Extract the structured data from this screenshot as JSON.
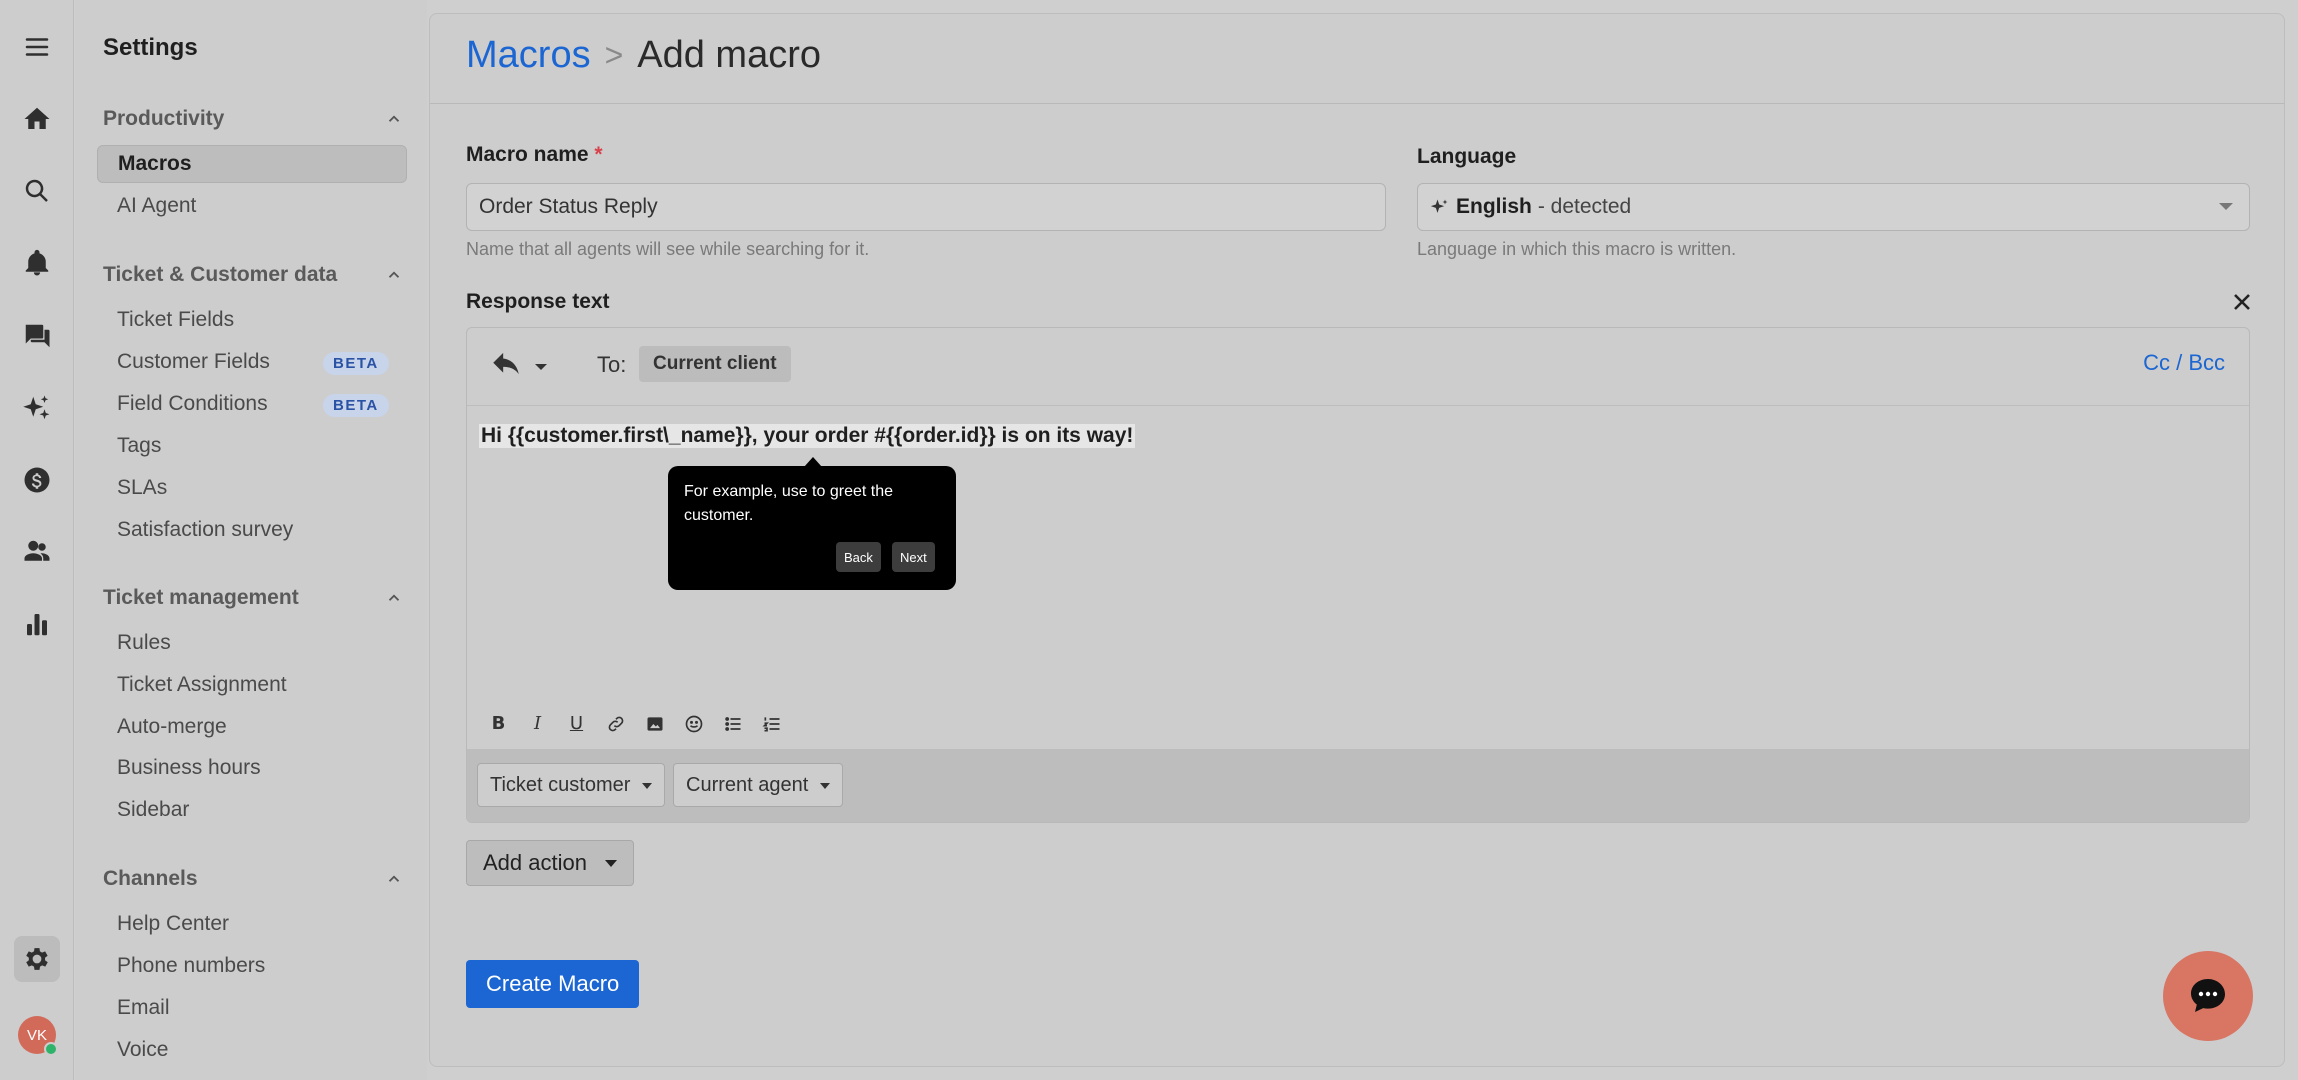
{
  "sidebar": {
    "title": "Settings",
    "sections": [
      {
        "label": "Productivity",
        "items": [
          {
            "label": "Macros"
          },
          {
            "label": "AI Agent"
          }
        ]
      },
      {
        "label": "Ticket & Customer data",
        "items": [
          {
            "label": "Ticket Fields"
          },
          {
            "label": "Customer Fields",
            "badge": "BETA"
          },
          {
            "label": "Field Conditions",
            "badge": "BETA"
          },
          {
            "label": "Tags"
          },
          {
            "label": "SLAs"
          },
          {
            "label": "Satisfaction survey"
          }
        ]
      },
      {
        "label": "Ticket management",
        "items": [
          {
            "label": "Rules"
          },
          {
            "label": "Ticket Assignment"
          },
          {
            "label": "Auto-merge"
          },
          {
            "label": "Business hours"
          },
          {
            "label": "Sidebar"
          }
        ]
      },
      {
        "label": "Channels",
        "items": [
          {
            "label": "Help Center"
          },
          {
            "label": "Phone numbers"
          },
          {
            "label": "Email"
          },
          {
            "label": "Voice"
          }
        ]
      }
    ]
  },
  "rail": {
    "avatar_initials": "VK"
  },
  "header": {
    "crumb_parent": "Macros",
    "crumb_sep": ">",
    "crumb_current": "Add macro"
  },
  "form": {
    "macro_name_label": "Macro name",
    "required_mark": "*",
    "macro_name_value": "Order Status Reply",
    "macro_name_hint": "Name that all agents will see while searching for it.",
    "language_label": "Language",
    "language_value": "English",
    "language_suffix": "- detected",
    "language_hint": "Language in which this macro is written.",
    "response_label": "Response text"
  },
  "editor": {
    "to_label": "To:",
    "to_chip": "Current client",
    "cc_bcc": "Cc / Bcc",
    "body": "Hi {{customer.first\\_name}}, your order #{{order.id}} is on its way!",
    "var_buttons": [
      "Ticket customer",
      "Current agent"
    ]
  },
  "tooltip": {
    "text": "For example, use to greet the customer.",
    "back": "Back",
    "next": "Next"
  },
  "actions": {
    "add_action": "Add action",
    "create": "Create Macro"
  },
  "colors": {
    "accent": "#1b66d2",
    "fab": "#d87563",
    "required": "#d8414b"
  }
}
